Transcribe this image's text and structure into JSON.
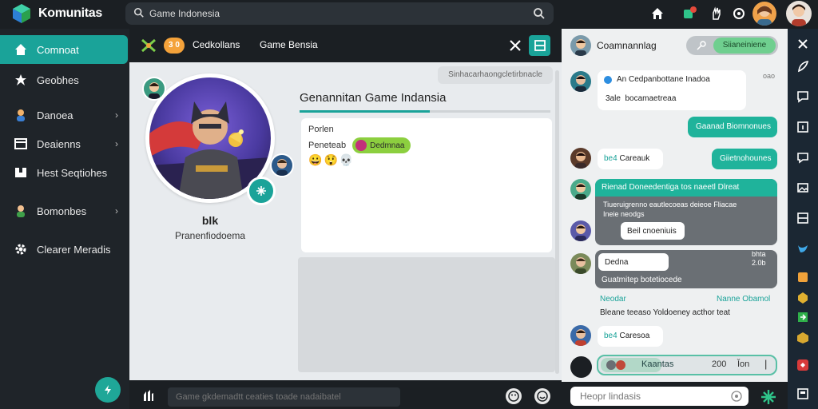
{
  "app": {
    "title": "Komunitas"
  },
  "search": {
    "value": "Game Indonesia"
  },
  "sidebar": {
    "items": [
      {
        "label": "Comnoat",
        "active": true
      },
      {
        "label": "Geobhes"
      },
      {
        "label": "Danoea"
      },
      {
        "label": "Deaienns"
      },
      {
        "label": "Hest Seqtiohes"
      },
      {
        "label": "Bomonbes"
      },
      {
        "label": "Clearer Meradis"
      }
    ]
  },
  "main": {
    "header": {
      "badge": "3 0",
      "tab1": "Cedkollans",
      "tab2": "Game Bensia"
    },
    "filter_chip": "Sinhacarhaongcletirbnacle",
    "profile": {
      "name": "blk",
      "subtitle": "Pranenfiodoema"
    },
    "post": {
      "title": "Genannitan Game Indansia",
      "progress": 0.52,
      "label": "Porlen",
      "row_label": "Peneteab",
      "tag": "Dedmnaa",
      "emojis": [
        "😀",
        "😲",
        "💀"
      ]
    },
    "composer": {
      "placeholder": "Game gkdemadtt ceaties toade nadaibatel"
    }
  },
  "chat": {
    "title": "Coamnannlag",
    "pill_label": "Siianeiniene",
    "messages": [
      {
        "line1": "Cedpanbottane Inadoa",
        "line1_prefix": "An",
        "line2": "bocamaetreaa",
        "line2_prefix": "3ale",
        "timestamp": "oao"
      },
      {
        "text": "Gaanad Biomnonues"
      },
      {
        "text": "Careauk",
        "prefix": "be4"
      },
      {
        "text": "Giietnohounes"
      },
      {
        "header": "Rienad Doneedentiga tos naeetl Dlreat",
        "body1": "Tiueruigrenno eautlecoeas deieoe Fliacae",
        "body2": "Ineie neodgs",
        "sub": "Beil cnoeniuis"
      },
      {
        "text": "Dedna",
        "timestamp1": "bhta",
        "timestamp2": "2.0b"
      },
      {
        "text": "Guatmitep botetiocede"
      },
      {
        "left": "Neodar",
        "right": "Nanne Obamol",
        "body": "Bleane teeaso Yoldoeney acthor teat"
      },
      {
        "text": "Caresoa",
        "prefix": "be4"
      }
    ],
    "input_bar": {
      "label": "Kaantas",
      "count": "200",
      "pct": "Ĭon"
    },
    "bottom": {
      "placeholder": "Heopr lindasis"
    }
  },
  "colors": {
    "accent": "#1aa399",
    "dark": "#1b1f23",
    "badge": "#f4a23a",
    "tag": "#8ccf3f"
  }
}
